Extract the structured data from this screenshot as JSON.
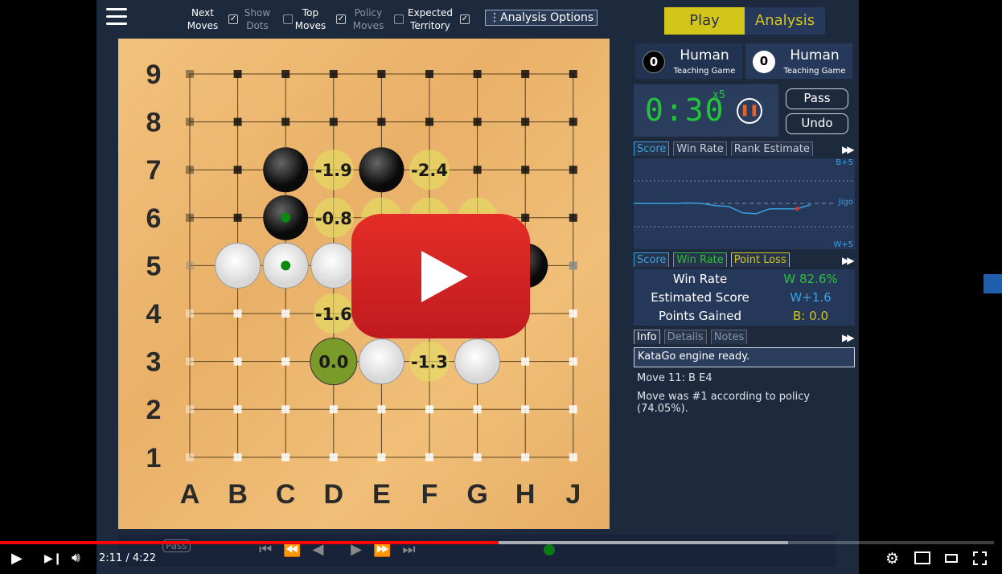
{
  "toolbar": {
    "options": [
      {
        "label": "Next Moves",
        "checked": true
      },
      {
        "label": "Show Dots",
        "checked": false
      },
      {
        "label": "Top Moves",
        "checked": true
      },
      {
        "label": "Policy Moves",
        "checked": false
      },
      {
        "label": "Expected Territory",
        "checked": true
      }
    ],
    "analysis_options": "⋮Analysis Options"
  },
  "board": {
    "columns": [
      "A",
      "B",
      "C",
      "D",
      "E",
      "F",
      "G",
      "H",
      "J"
    ],
    "rows": [
      "9",
      "8",
      "7",
      "6",
      "5",
      "4",
      "3",
      "2",
      "1"
    ],
    "black_stones": [
      "C7",
      "E7",
      "C6",
      "H5"
    ],
    "white_stones": [
      "B5",
      "C5",
      "D5",
      "E3",
      "G3"
    ],
    "last_move_markers": [
      "C6",
      "C5"
    ],
    "hints": [
      {
        "point": "D7",
        "label": "-1.9"
      },
      {
        "point": "F7",
        "label": "-2.4"
      },
      {
        "point": "D6",
        "label": "-0.8"
      },
      {
        "point": "D4",
        "label": "-1.6"
      },
      {
        "point": "D3",
        "label": "0.0",
        "best": true
      },
      {
        "point": "F3",
        "label": "-1.3"
      },
      {
        "point": "E6",
        "label": ""
      },
      {
        "point": "F6",
        "label": ""
      },
      {
        "point": "G6",
        "label": ""
      }
    ]
  },
  "mode": {
    "play": "Play",
    "analysis": "Analysis",
    "active_color": "#d4c51a",
    "inactive_text_color": "#d4c51a"
  },
  "players": [
    {
      "captures": "0",
      "name": "Human",
      "type": "Teaching Game",
      "color": "black"
    },
    {
      "captures": "0",
      "name": "Human",
      "type": "Teaching Game",
      "color": "white"
    }
  ],
  "timer": {
    "time": "0:30",
    "periods": "x5",
    "pause_icon": "pause-icon"
  },
  "buttons": {
    "pass": "Pass",
    "undo": "Undo"
  },
  "graph_tabs": [
    "Score",
    "Win Rate",
    "Rank Estimate"
  ],
  "graph": {
    "top_label": "B+5",
    "mid_label": "Jigo",
    "bottom_label": "W+5",
    "score_series": [
      0,
      0,
      0,
      0,
      0.1,
      0,
      -0.5,
      -0.7,
      -2.1,
      -2.3,
      -1.2,
      -1.2,
      -1.2,
      -0.3
    ]
  },
  "stat_tabs": [
    "Score",
    "Win Rate",
    "Point Loss"
  ],
  "stats": [
    {
      "label": "Win Rate",
      "value": "W 82.6%",
      "color": "#2fbf3a"
    },
    {
      "label": "Estimated Score",
      "value": "W+1.6",
      "color": "#3aa0e0"
    },
    {
      "label": "Points Gained",
      "value": "B: 0.0",
      "color": "#d4c51a"
    }
  ],
  "info_tabs": [
    "Info",
    "Details",
    "Notes"
  ],
  "info": {
    "status": "KataGo engine ready.",
    "move": "Move 11: B E4",
    "policy": "Move was #1 according to policy  (74.05%)."
  },
  "bottom": {
    "pass": "Pass"
  },
  "player": {
    "time": "2:11 / 4:22",
    "progress_fraction": 0.5,
    "buffered_fraction": 0.79
  }
}
